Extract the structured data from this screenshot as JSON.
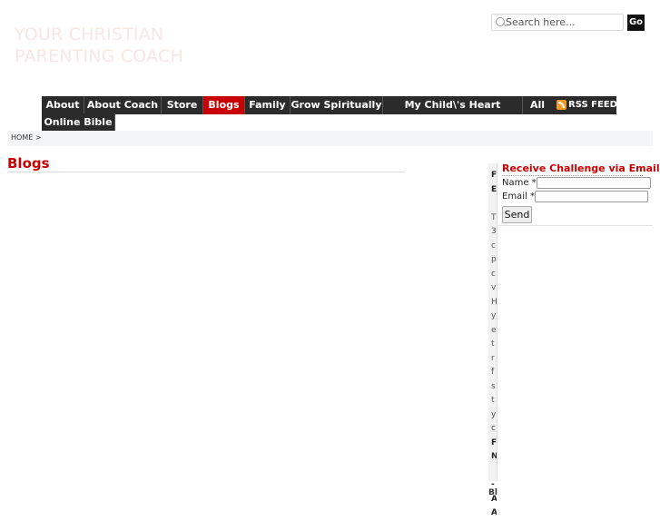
{
  "site": {
    "title_line1": "YOUR CHRISTIAN",
    "title_line2": "PARENTING COACH"
  },
  "search": {
    "placeholder": "Search here...",
    "go_label": "Go"
  },
  "nav": {
    "items": [
      {
        "label": "About",
        "active": false
      },
      {
        "label": "About Coach",
        "active": false
      },
      {
        "label": "Store",
        "active": false
      },
      {
        "label": "Blogs",
        "active": true
      },
      {
        "label": "Family",
        "active": false
      },
      {
        "label": "Grow Spiritually",
        "active": false
      },
      {
        "label": "My Child\\'s Heart Ministry",
        "active": false
      },
      {
        "label": "All Products",
        "active": false
      },
      {
        "label": "Online Bible",
        "active": false
      }
    ],
    "rss_label": "RSS FEED"
  },
  "breadcrumb": "HOME >",
  "page": {
    "title": "Blogs"
  },
  "sidebar_peek": {
    "lines": [
      "F",
      "E",
      "",
      "T",
      "3",
      "c",
      "p",
      "c",
      "v",
      "H",
      "y",
      "e",
      "t",
      "r",
      "f",
      "s",
      "t",
      "y",
      "c",
      "F",
      "N",
      "",
      "-",
      "A",
      "A"
    ],
    "footer_peek": "Bl"
  },
  "signup": {
    "heading": "Receive Challenge via Email",
    "name_label": "Name *",
    "email_label": "Email *",
    "send_label": "Send"
  },
  "colors": {
    "accent": "#c80000",
    "nav_bg": "#2b2b2b"
  }
}
